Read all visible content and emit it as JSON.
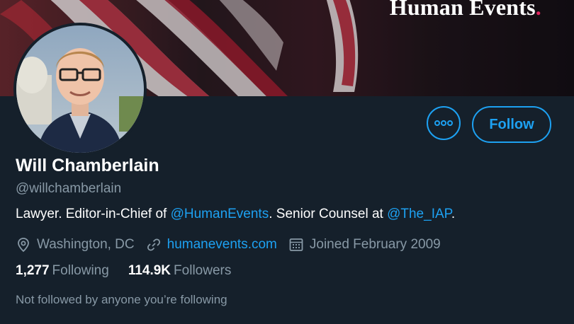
{
  "banner": {
    "title": "Human Events",
    "title_dot": "."
  },
  "actions": {
    "more_icon": "more-horizontal-icon",
    "follow_label": "Follow"
  },
  "profile": {
    "display_name": "Will Chamberlain",
    "handle": "@willchamberlain",
    "bio": {
      "part1": "Lawyer. Editor-in-Chief of ",
      "mention1": "@HumanEvents",
      "part2": ". Senior Counsel at ",
      "mention2": "@The_IAP",
      "part3": "."
    },
    "location": "Washington, DC",
    "website": "humanevents.com",
    "joined": "Joined February 2009"
  },
  "stats": {
    "following_count": "1,277",
    "following_label": "Following",
    "followers_count": "114.9K",
    "followers_label": "Followers"
  },
  "note": "Not followed by anyone you’re following",
  "colors": {
    "background": "#15202b",
    "accent": "#1da1f2",
    "secondary_text": "#8899a6",
    "brand_dot": "#e0245e"
  }
}
